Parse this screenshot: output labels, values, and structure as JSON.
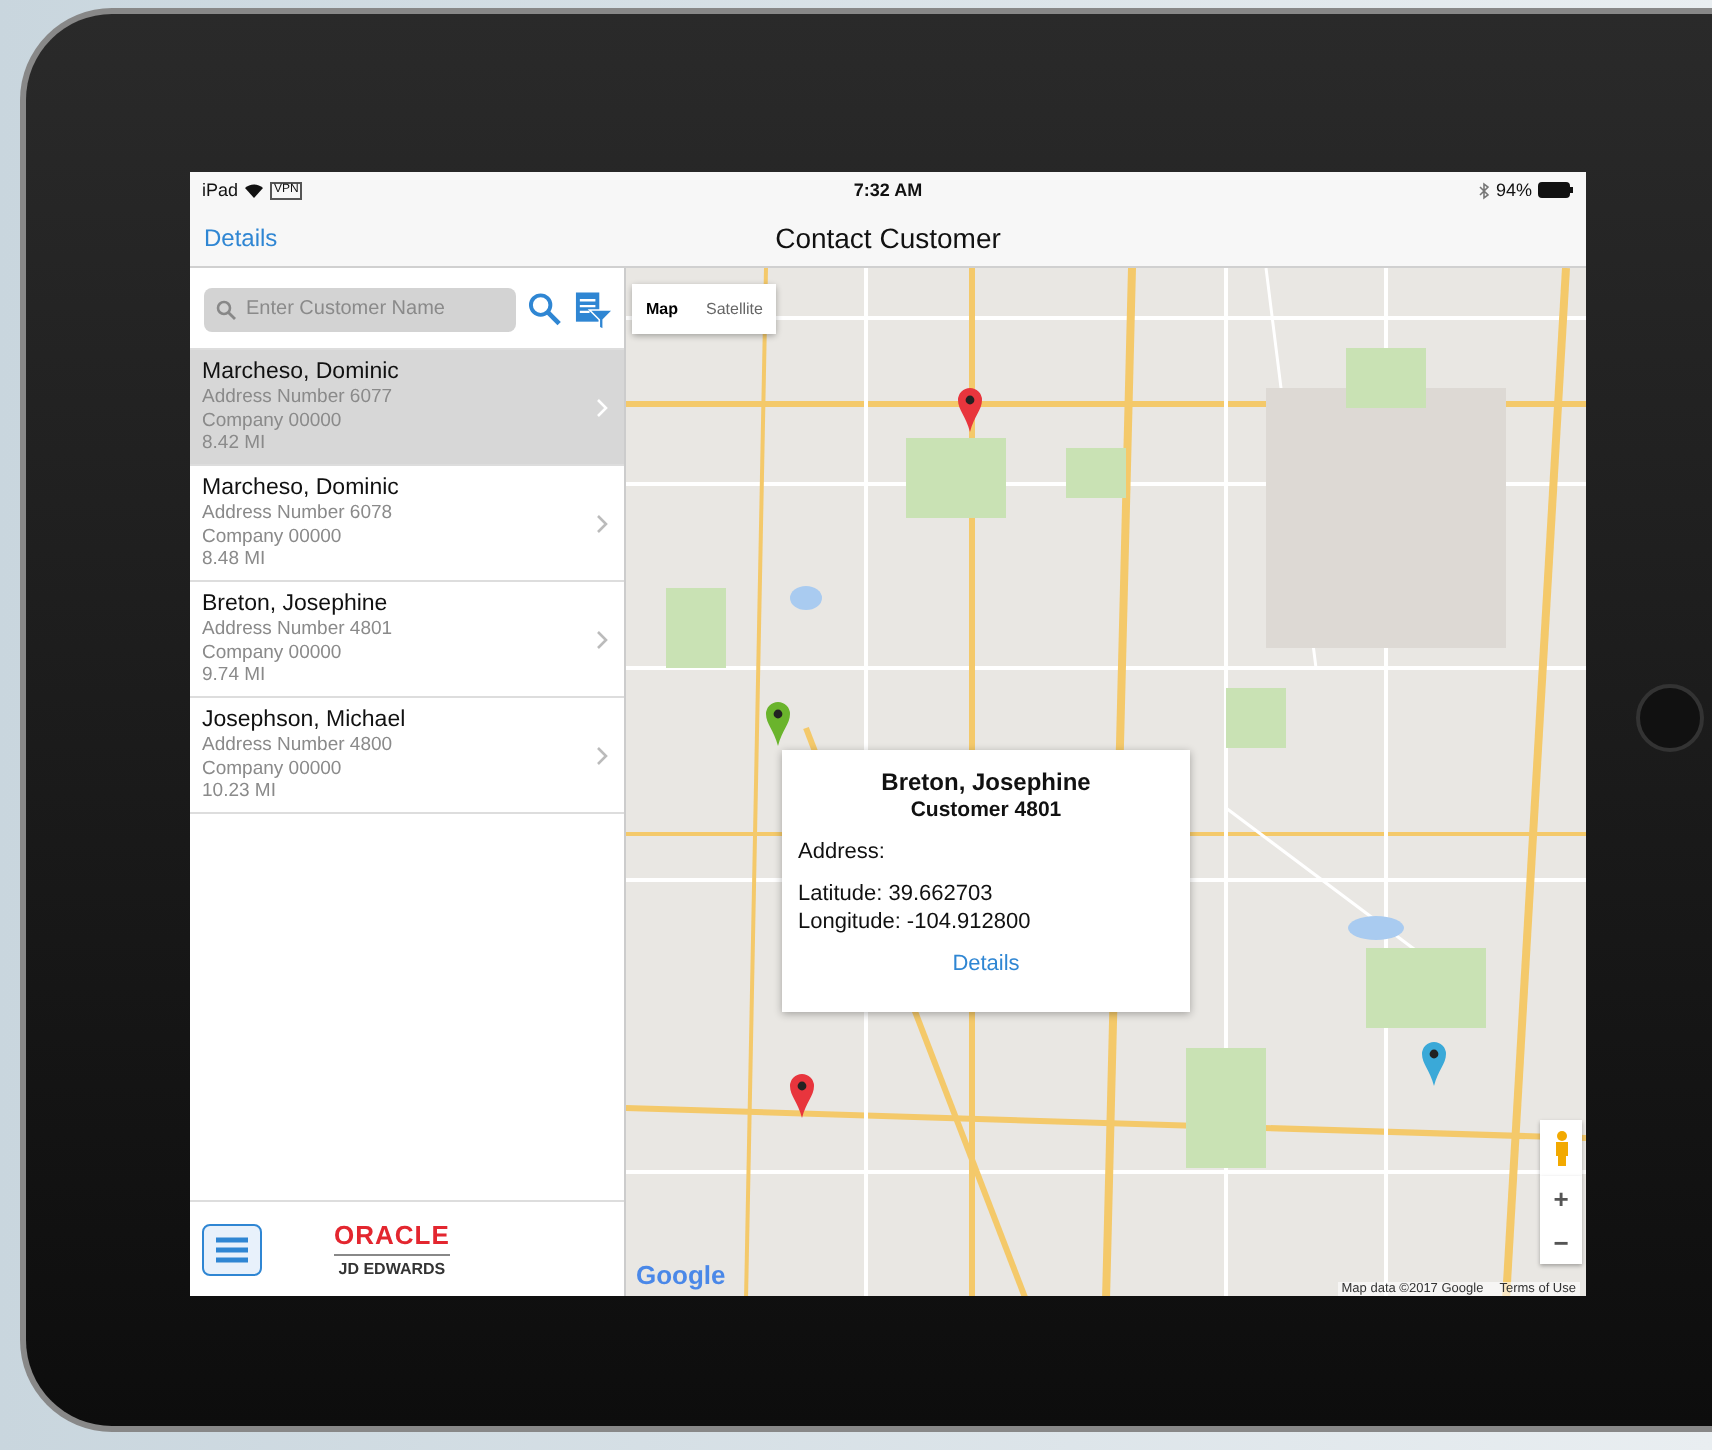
{
  "status_bar": {
    "device": "iPad",
    "vpn": "VPN",
    "time": "7:32 AM",
    "battery": "94%"
  },
  "nav_bar": {
    "back": "Details",
    "title": "Contact Customer"
  },
  "search": {
    "placeholder": "Enter Customer Name"
  },
  "customers": [
    {
      "name": "Marcheso, Dominic",
      "address": "Address Number 6077",
      "company": "Company 00000",
      "distance": "8.42 MI",
      "selected": true
    },
    {
      "name": "Marcheso, Dominic",
      "address": "Address Number 6078",
      "company": "Company 00000",
      "distance": "8.48 MI",
      "selected": false
    },
    {
      "name": "Breton, Josephine",
      "address": "Address Number 4801",
      "company": "Company 00000",
      "distance": "9.74 MI",
      "selected": false
    },
    {
      "name": "Josephson, Michael",
      "address": "Address Number 4800",
      "company": "Company 00000",
      "distance": "10.23 MI",
      "selected": false
    }
  ],
  "footer": {
    "logo": "ORACLE",
    "sublogo": "JD EDWARDS"
  },
  "map": {
    "type_toggle": [
      {
        "label": "Map",
        "selected": true
      },
      {
        "label": "Satellite",
        "selected": false
      }
    ],
    "pins": [
      {
        "color": "#e8353d"
      },
      {
        "color": "#6ab42c"
      },
      {
        "color": "#e8353d"
      },
      {
        "color": "#3aa9d8"
      }
    ],
    "popup": {
      "title": "Breton, Josephine",
      "subtitle": "Customer 4801",
      "address_label": "Address:",
      "latitude": "Latitude: 39.662703",
      "longitude": "Longitude: -104.912800",
      "link": "Details"
    },
    "zoom_in": "+",
    "zoom_out": "−",
    "logo": "Google",
    "attribution": "Map data ©2017 Google",
    "terms": "Terms of Use"
  }
}
